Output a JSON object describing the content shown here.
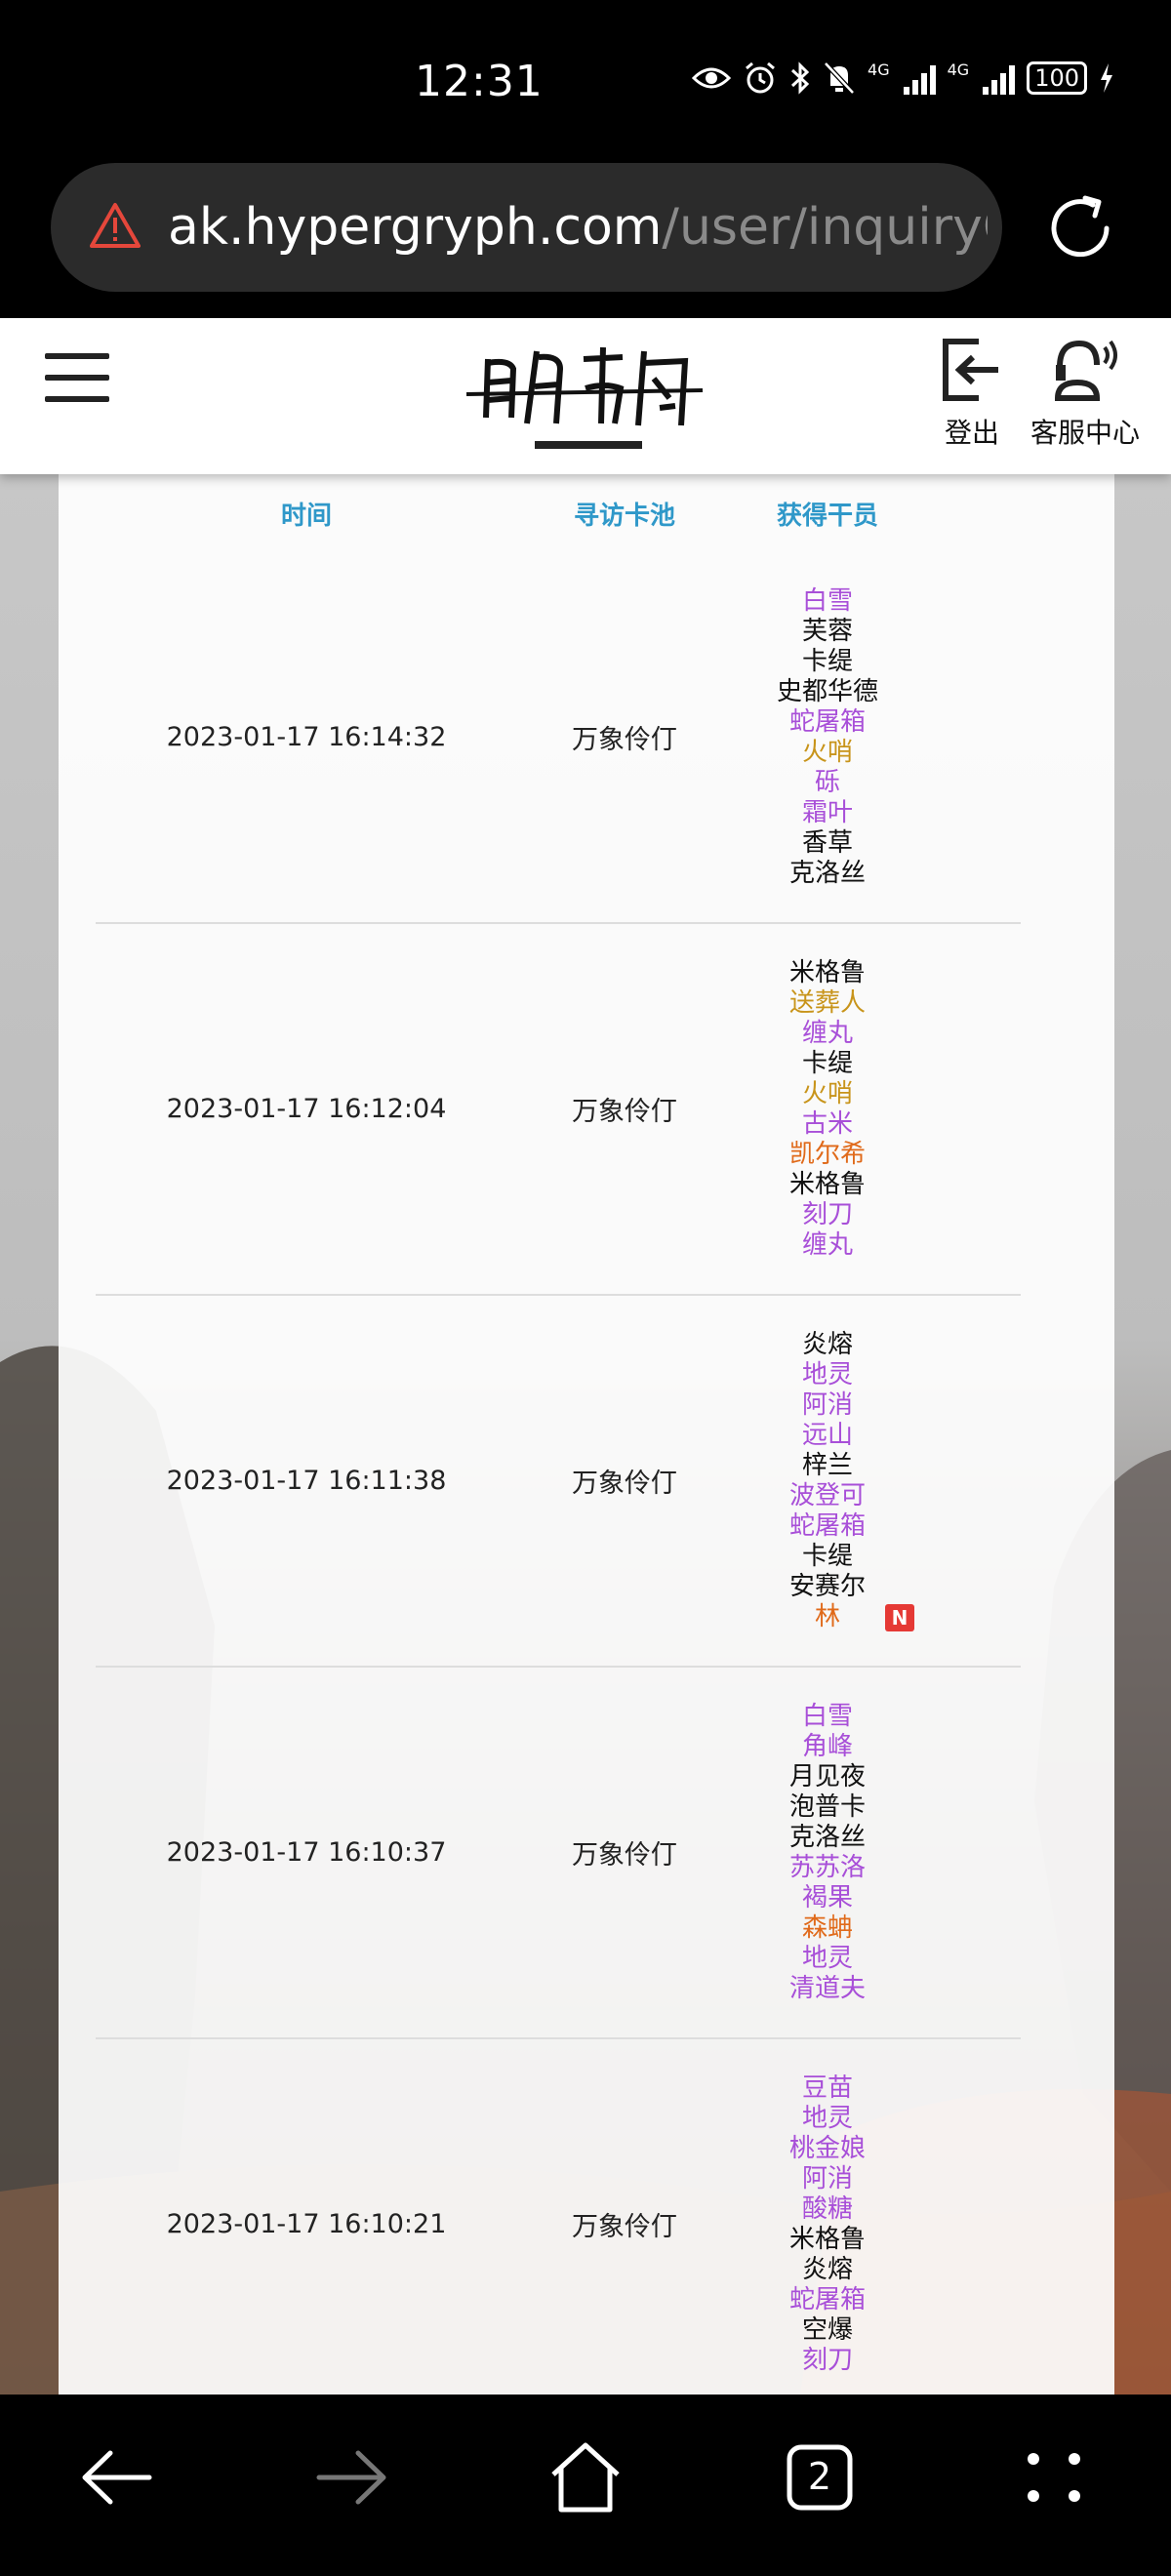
{
  "status_bar": {
    "time": "12:31",
    "net_label": "4G",
    "battery": "100",
    "icons": [
      "eye-icon",
      "alarm-icon",
      "bluetooth-icon",
      "mute-icon",
      "signal-icon",
      "signal-icon",
      "battery-icon",
      "charging-icon"
    ]
  },
  "browser": {
    "url_host": "ak.hypergryph.com",
    "url_path": "/user/inquiryGa",
    "tab_count": "2"
  },
  "header": {
    "logo_text": "明日方舟",
    "logout_label": "登出",
    "service_label": "客服中心"
  },
  "table": {
    "columns": [
      "时间",
      "寻访卡池",
      "获得干员"
    ],
    "rows": [
      {
        "time": "2023-01-17 16:14:32",
        "pool": "万象伶仃",
        "operators": [
          {
            "name": "白雪",
            "rarity": "purple"
          },
          {
            "name": "芙蓉",
            "rarity": "black"
          },
          {
            "name": "卡缇",
            "rarity": "black"
          },
          {
            "name": "史都华德",
            "rarity": "black"
          },
          {
            "name": "蛇屠箱",
            "rarity": "purple"
          },
          {
            "name": "火哨",
            "rarity": "gold"
          },
          {
            "name": "砾",
            "rarity": "purple"
          },
          {
            "name": "霜叶",
            "rarity": "purple"
          },
          {
            "name": "香草",
            "rarity": "black"
          },
          {
            "name": "克洛丝",
            "rarity": "black"
          }
        ]
      },
      {
        "time": "2023-01-17 16:12:04",
        "pool": "万象伶仃",
        "operators": [
          {
            "name": "米格鲁",
            "rarity": "black"
          },
          {
            "name": "送葬人",
            "rarity": "gold"
          },
          {
            "name": "缠丸",
            "rarity": "purple"
          },
          {
            "name": "卡缇",
            "rarity": "black"
          },
          {
            "name": "火哨",
            "rarity": "gold"
          },
          {
            "name": "古米",
            "rarity": "purple"
          },
          {
            "name": "凯尔希",
            "rarity": "orange"
          },
          {
            "name": "米格鲁",
            "rarity": "black"
          },
          {
            "name": "刻刀",
            "rarity": "purple"
          },
          {
            "name": "缠丸",
            "rarity": "purple"
          }
        ]
      },
      {
        "time": "2023-01-17 16:11:38",
        "pool": "万象伶仃",
        "operators": [
          {
            "name": "炎熔",
            "rarity": "black"
          },
          {
            "name": "地灵",
            "rarity": "purple"
          },
          {
            "name": "阿消",
            "rarity": "purple"
          },
          {
            "name": "远山",
            "rarity": "purple"
          },
          {
            "name": "梓兰",
            "rarity": "black"
          },
          {
            "name": "波登可",
            "rarity": "purple"
          },
          {
            "name": "蛇屠箱",
            "rarity": "purple"
          },
          {
            "name": "卡缇",
            "rarity": "black"
          },
          {
            "name": "安赛尔",
            "rarity": "black"
          },
          {
            "name": "林",
            "rarity": "orange",
            "badge": "N"
          }
        ]
      },
      {
        "time": "2023-01-17 16:10:37",
        "pool": "万象伶仃",
        "operators": [
          {
            "name": "白雪",
            "rarity": "purple"
          },
          {
            "name": "角峰",
            "rarity": "purple"
          },
          {
            "name": "月见夜",
            "rarity": "black"
          },
          {
            "name": "泡普卡",
            "rarity": "black"
          },
          {
            "name": "克洛丝",
            "rarity": "black"
          },
          {
            "name": "苏苏洛",
            "rarity": "purple"
          },
          {
            "name": "褐果",
            "rarity": "purple"
          },
          {
            "name": "森蚺",
            "rarity": "orange"
          },
          {
            "name": "地灵",
            "rarity": "purple"
          },
          {
            "name": "清道夫",
            "rarity": "purple"
          }
        ]
      },
      {
        "time": "2023-01-17 16:10:21",
        "pool": "万象伶仃",
        "operators": [
          {
            "name": "豆苗",
            "rarity": "purple"
          },
          {
            "name": "地灵",
            "rarity": "purple"
          },
          {
            "name": "桃金娘",
            "rarity": "purple"
          },
          {
            "name": "阿消",
            "rarity": "purple"
          },
          {
            "name": "酸糖",
            "rarity": "purple"
          },
          {
            "name": "米格鲁",
            "rarity": "black"
          },
          {
            "name": "炎熔",
            "rarity": "black"
          },
          {
            "name": "蛇屠箱",
            "rarity": "purple"
          },
          {
            "name": "空爆",
            "rarity": "black"
          },
          {
            "name": "刻刀",
            "rarity": "purple"
          }
        ]
      }
    ]
  },
  "colors": {
    "header_accent": "#2f98c9",
    "rarity_purple": "#a84fd8",
    "rarity_gold": "#c8941a",
    "rarity_orange": "#e06a1a",
    "new_badge": "#e53935"
  }
}
